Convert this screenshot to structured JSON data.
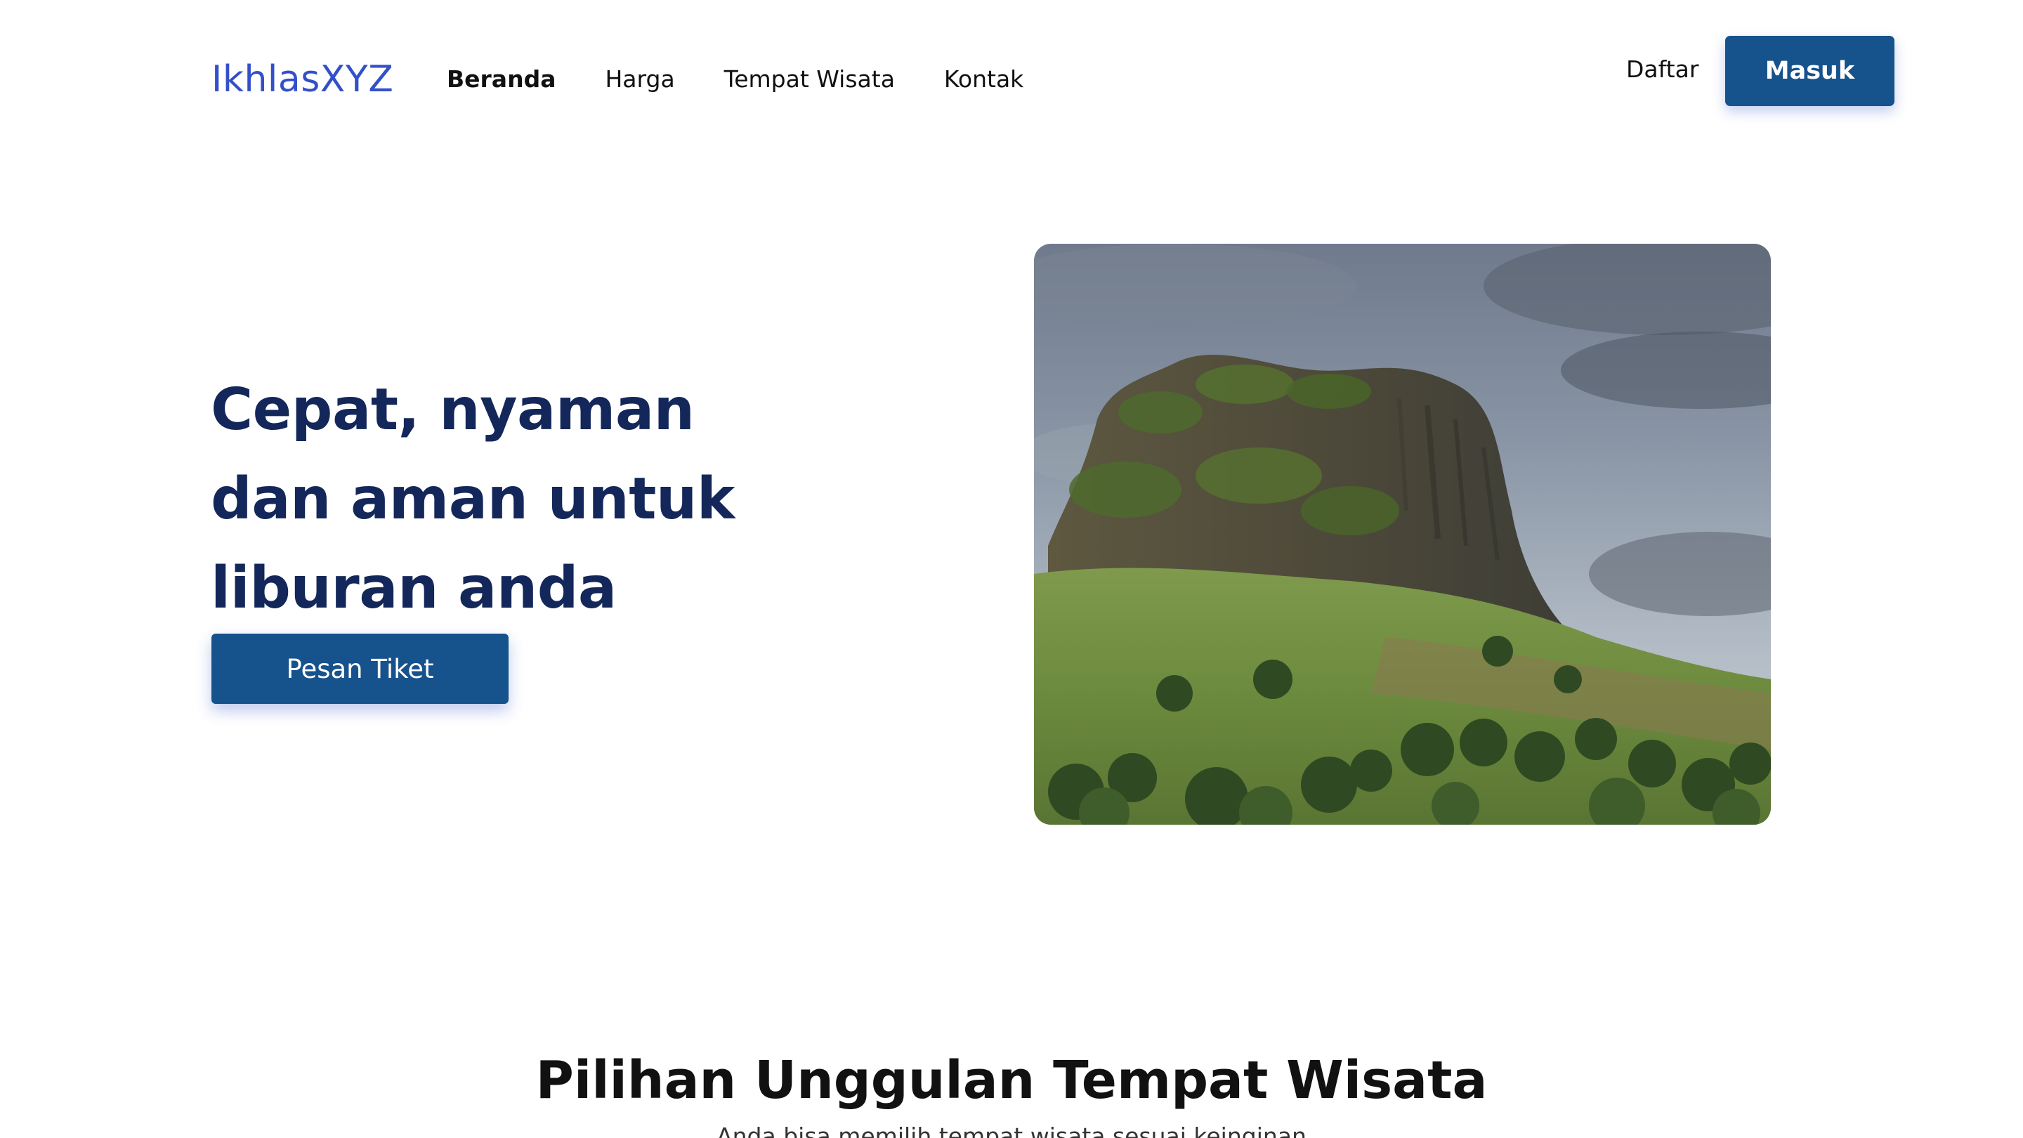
{
  "navbar": {
    "logo": "IkhlasXYZ",
    "links": [
      {
        "label": "Beranda",
        "active": true
      },
      {
        "label": "Harga",
        "active": false
      },
      {
        "label": "Tempat Wisata",
        "active": false
      },
      {
        "label": "Kontak",
        "active": false
      }
    ],
    "register_label": "Daftar",
    "login_label": "Masuk"
  },
  "hero": {
    "title_lines": [
      "Cepat, nyaman",
      "dan aman untuk",
      "liburan anda"
    ],
    "cta_label": "Pesan Tiket",
    "image_icon": "mountain-landscape-photo"
  },
  "featured": {
    "title": "Pilihan Unggulan Tempat Wisata",
    "subtitle": "Anda bisa memilih tempat wisata sesuai keinginan"
  },
  "colors": {
    "brand": "#3350c9",
    "primary_button": "#16528c",
    "hero_heading": "#14275a"
  }
}
